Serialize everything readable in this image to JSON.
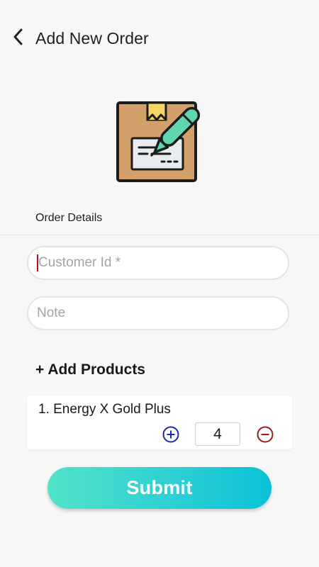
{
  "header": {
    "title": "Add New Order",
    "back_icon": "chevron-left-icon"
  },
  "hero": {
    "icon": "box-with-pen-icon",
    "colors": {
      "box": "#d4a06a",
      "label": "#e9ecef",
      "pen": "#5fd6b0",
      "tape": "#f7d564"
    }
  },
  "section": {
    "order_details_label": "Order Details"
  },
  "form": {
    "customer_id": {
      "value": "",
      "placeholder": "Customer Id *"
    },
    "note": {
      "value": "",
      "placeholder": "Note"
    }
  },
  "products": {
    "add_label": "+ Add Products",
    "items": [
      {
        "name": "1. Energy X Gold Plus",
        "quantity": "4",
        "plus_icon": "plus-circle-icon",
        "minus_icon": "minus-circle-icon"
      }
    ]
  },
  "submit": {
    "label": "Submit"
  },
  "colors": {
    "plus": "#1f2aa8",
    "minus": "#9b1b1b",
    "accent_start": "#52e3c8",
    "accent_end": "#0bc1d8"
  }
}
